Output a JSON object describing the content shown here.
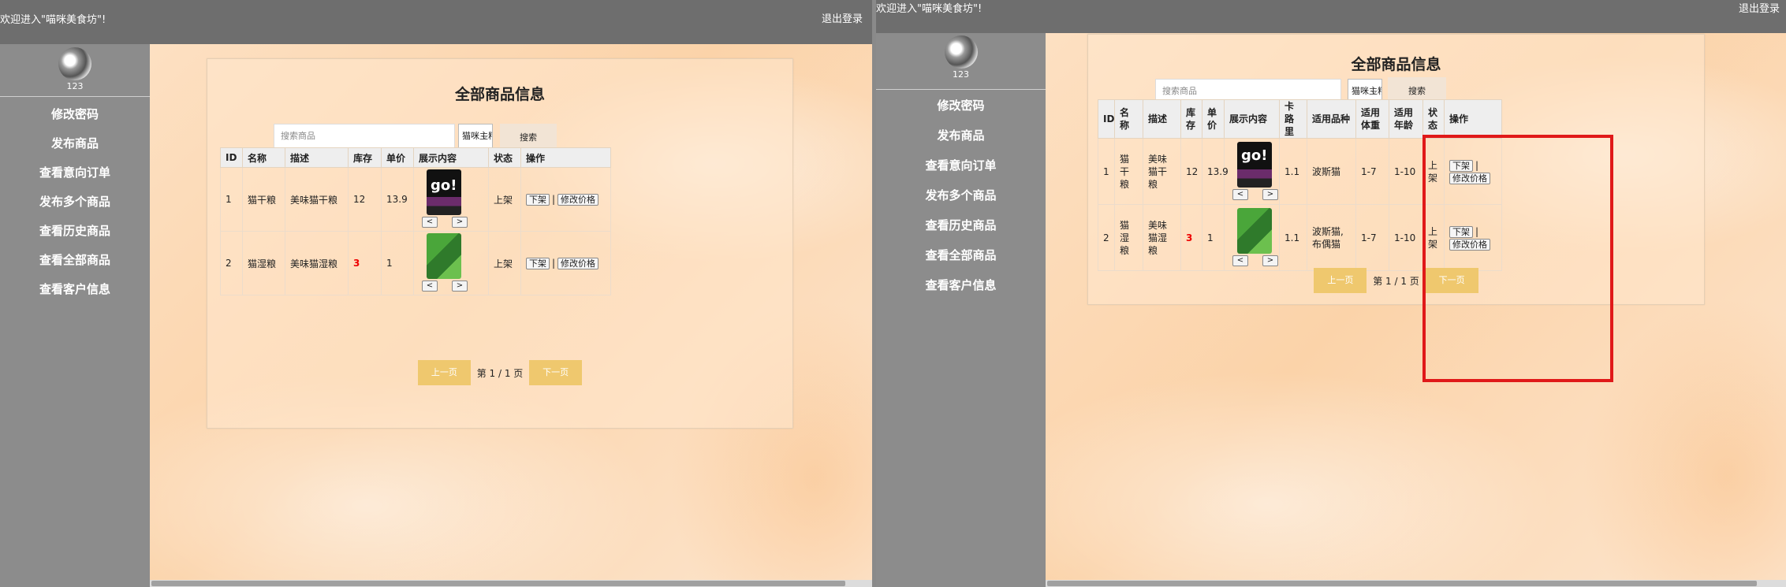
{
  "left": {
    "welcome": "欢迎进入\"喵咪美食坊\"!",
    "logout": "退出登录",
    "username": "123",
    "menu": [
      "修改密码",
      "发布商品",
      "查看意向订单",
      "发布多个商品",
      "查看历史商品",
      "查看全部商品",
      "查看客户信息"
    ],
    "title": "全部商品信息",
    "search_placeholder": "搜索商品",
    "select_value": "猫咪主粮",
    "search_btn": "搜索",
    "headers": [
      "ID",
      "名称",
      "描述",
      "库存",
      "单价",
      "展示内容",
      "状态",
      "操作"
    ],
    "rows": [
      {
        "id": "1",
        "name": "猫干粮",
        "desc": "美味猫干粮",
        "stock": "12",
        "price": "13.9",
        "status": "上架"
      },
      {
        "id": "2",
        "name": "猫湿粮",
        "desc": "美味猫湿粮",
        "stock": "3",
        "price": "1",
        "status": "上架"
      }
    ],
    "prev_arrow": "<",
    "next_arrow": ">",
    "op_takedown": "下架",
    "op_sep": "|",
    "op_edit": "修改价格",
    "pager": {
      "prev": "上一页",
      "info": "第 1 / 1 页",
      "next": "下一页"
    }
  },
  "right": {
    "welcome": "欢迎进入\"喵咪美食坊\"!",
    "logout": "退出登录",
    "username": "123",
    "menu": [
      "修改密码",
      "发布商品",
      "查看意向订单",
      "发布多个商品",
      "查看历史商品",
      "查看全部商品",
      "查看客户信息"
    ],
    "title": "全部商品信息",
    "search_placeholder": "搜索商品",
    "select_value": "猫咪主粮",
    "search_btn": "搜索",
    "headers": [
      "ID",
      "名称",
      "描述",
      "库存",
      "单价",
      "展示内容",
      "卡路里",
      "适用品种",
      "适用体重",
      "适用年龄",
      "状态",
      "操作"
    ],
    "rows": [
      {
        "id": "1",
        "name": "猫干粮",
        "desc": "美味猫干粮",
        "stock": "12",
        "price": "13.9",
        "calorie": "1.1",
        "breed": "波斯猫",
        "weight": "1-7",
        "age": "1-10",
        "status": "上架"
      },
      {
        "id": "2",
        "name": "猫湿粮",
        "desc": "美味猫湿粮",
        "stock": "3",
        "price": "1",
        "calorie": "1.1",
        "breed": "波斯猫,布偶猫",
        "weight": "1-7",
        "age": "1-10",
        "status": "上架"
      }
    ],
    "prev_arrow": "<",
    "next_arrow": ">",
    "op_takedown": "下架",
    "op_sep": "|",
    "op_edit": "修改价格",
    "pager": {
      "prev": "上一页",
      "info": "第 1 / 1 页",
      "next": "下一页"
    }
  },
  "colors": {
    "topbar": "#6e6e6e",
    "sidebar": "#8c8c8c",
    "pager_btn": "#efc86e",
    "low_stock": "#e00000",
    "highlight_box": "#e01919"
  }
}
